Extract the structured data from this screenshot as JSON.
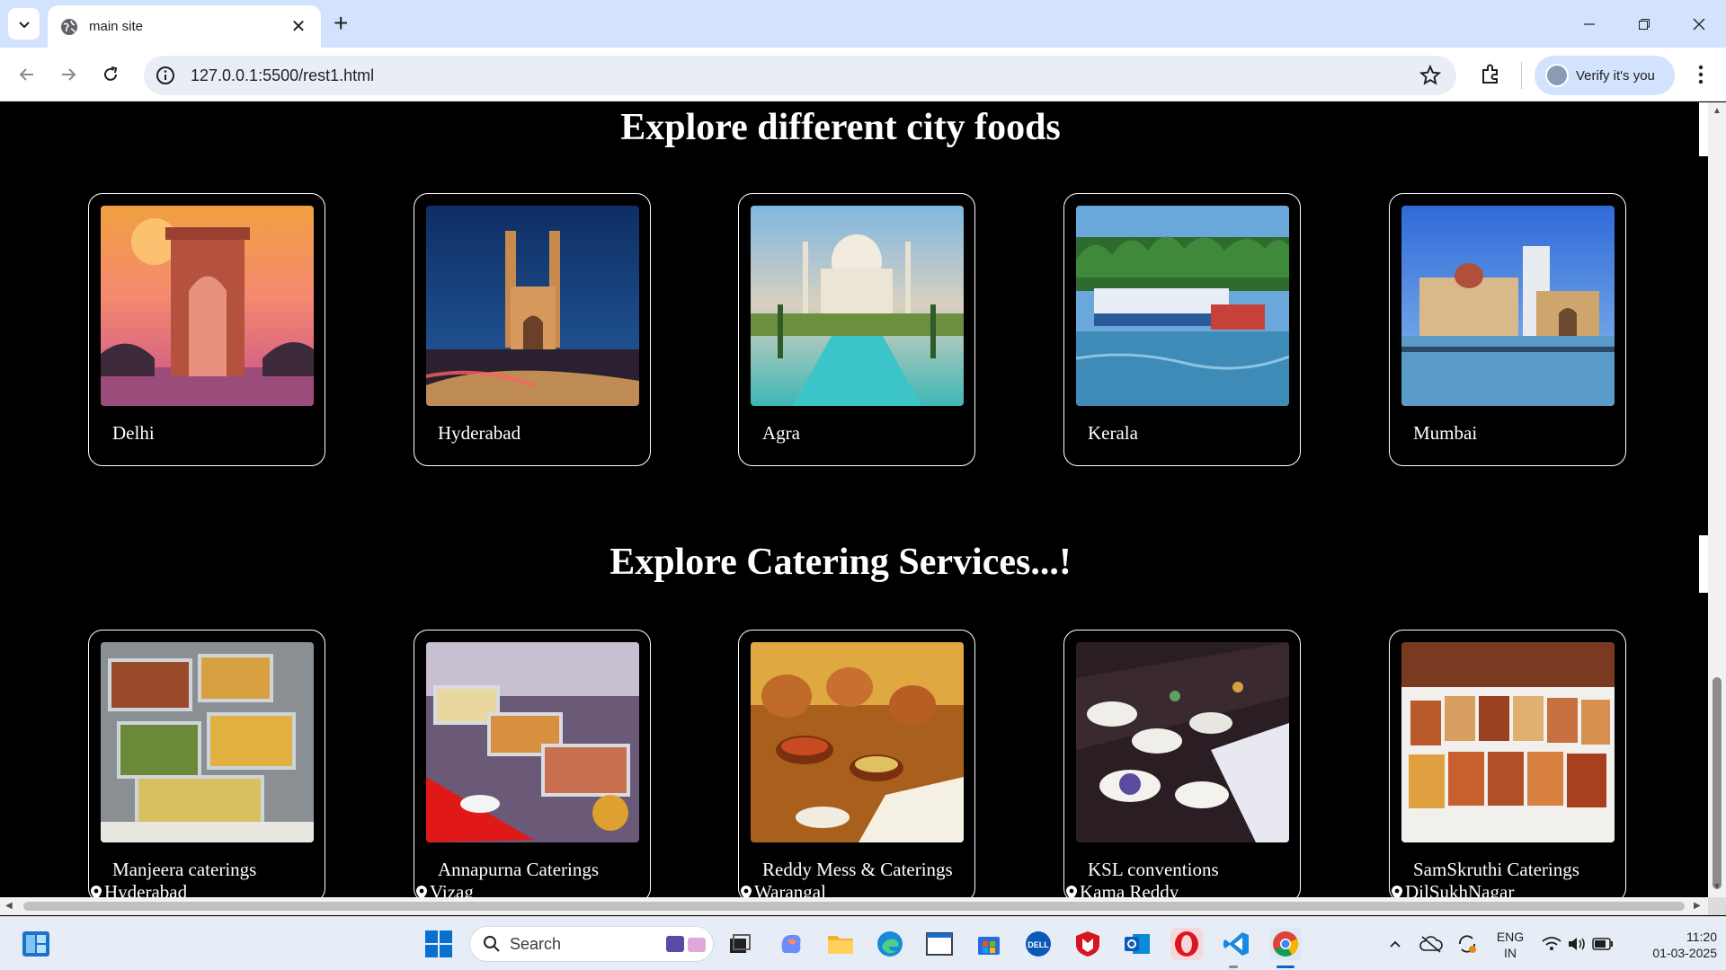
{
  "browser": {
    "tab_title": "main site",
    "url": "127.0.0.1:5500/rest1.html",
    "profile_button": "Verify it's you"
  },
  "page": {
    "cities_heading": "Explore different city foods",
    "catering_heading": "Explore Catering Services...!",
    "cities": [
      {
        "name": "Delhi",
        "image": "india-gate-photo"
      },
      {
        "name": "Hyderabad",
        "image": "charminar-photo"
      },
      {
        "name": "Agra",
        "image": "taj-mahal-photo"
      },
      {
        "name": "Kerala",
        "image": "kerala-boats-photo"
      },
      {
        "name": "Mumbai",
        "image": "gateway-of-india-photo"
      }
    ],
    "caterers": [
      {
        "name": "Manjeera caterings",
        "location": "Hyderabad",
        "image": "buffet-trays-photo"
      },
      {
        "name": "Annapurna Caterings",
        "location": "Vizag",
        "image": "chafing-dishes-photo"
      },
      {
        "name": "Reddy Mess & Caterings",
        "location": "Warangal",
        "image": "copper-pots-photo"
      },
      {
        "name": "KSL conventions",
        "location": "Kama Reddy",
        "image": "banquet-table-photo"
      },
      {
        "name": "SamSkruthi Caterings",
        "location": "DilSukhNagar",
        "image": "food-trays-photo"
      }
    ]
  },
  "taskbar": {
    "search_placeholder": "Search",
    "language_top": "ENG",
    "language_bottom": "IN",
    "time": "11:20",
    "date": "01-03-2025"
  },
  "colors": {
    "tabbar_bg": "#d3e3fd",
    "page_bg": "#000000",
    "text": "#ffffff"
  }
}
